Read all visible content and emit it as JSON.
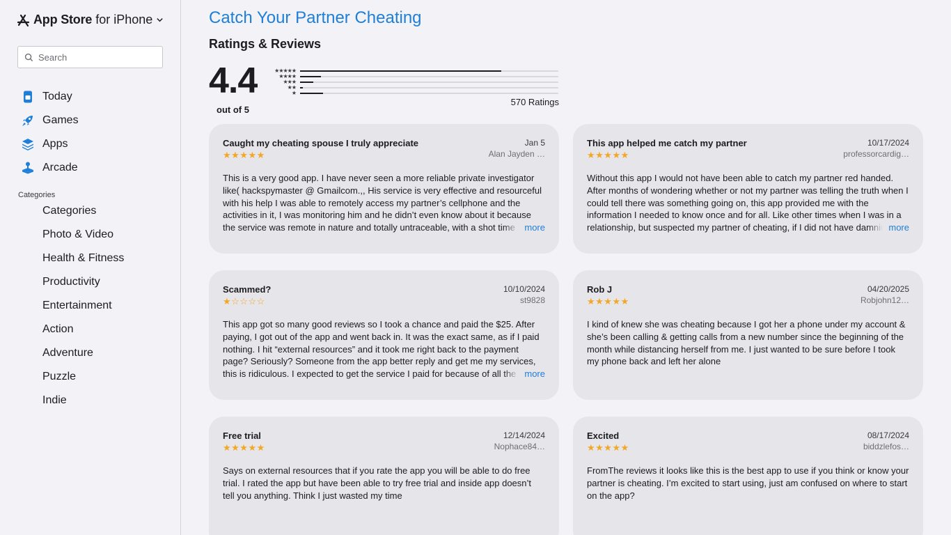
{
  "brand": {
    "name": "App Store",
    "suffix": "for iPhone"
  },
  "search": {
    "placeholder": "Search"
  },
  "nav": [
    {
      "label": "Today",
      "icon": "today-icon"
    },
    {
      "label": "Games",
      "icon": "games-rocket-icon"
    },
    {
      "label": "Apps",
      "icon": "apps-layers-icon"
    },
    {
      "label": "Arcade",
      "icon": "arcade-joystick-icon"
    }
  ],
  "categories_heading": "Categories",
  "categories": [
    "Categories",
    "Photo & Video",
    "Health & Fitness",
    "Productivity",
    "Entertainment",
    "Action",
    "Adventure",
    "Puzzle",
    "Indie"
  ],
  "app_title": "Catch Your Partner Cheating",
  "ratings": {
    "heading": "Ratings & Reviews",
    "score": "4.4",
    "out_of": "out of 5",
    "count": "570 Ratings",
    "distribution": [
      {
        "stars": "★★★★★",
        "fraction": 0.78
      },
      {
        "stars": "★★★★",
        "fraction": 0.08
      },
      {
        "stars": "★★★",
        "fraction": 0.05
      },
      {
        "stars": "★★",
        "fraction": 0.01
      },
      {
        "stars": "★",
        "fraction": 0.09
      }
    ]
  },
  "accent_color": "#1f7fd8",
  "star_color": "#f5a623",
  "reviews": [
    {
      "title": "Caught my cheating spouse I truly appreciate",
      "date": "Jan 5",
      "author": "Alan Jayden …",
      "stars": "★★★★★",
      "body": "This is a very good app. I have never seen a more reliable private investigator like( hackspymaster @ Gmailcom.,, His service is very effective and resourceful with his help I was able to remotely access my partner’s cellphone and the activities in it, I was monitoring him and he didn’t even know about it because the service was remote in nature and totally untraceable, with a shot time he",
      "more": "more"
    },
    {
      "title": "This app helped me catch my partner",
      "date": "10/17/2024",
      "author": "professorcardig…",
      "stars": "★★★★★",
      "body": "Without this app I would not have been able to catch my partner red handed. After months of wondering whether or not my partner was telling the truth when I could tell there was something going on, this app provided me with the information I needed to know once and for all. Like other times when I was in a relationship, but suspected my partner of cheating, if I did not have damning evidence",
      "more": "more"
    },
    {
      "title": "Scammed?",
      "date": "10/10/2024",
      "author": "st9828",
      "stars": "★☆☆☆☆",
      "body": "This app got so many good reviews so I took a chance and paid the $25. After paying, I got out of the app and went back in. It was the exact same, as if I paid nothing. I hit “external resources” and it took me right back to the payment page? Seriously? Someone from the app better reply and get me my services, this is ridiculous. I expected to get the service I paid for because of all the good",
      "more": "more"
    },
    {
      "title": "Rob J",
      "date": "04/20/2025",
      "author": "Robjohn12…",
      "stars": "★★★★★",
      "body": "I kind of knew she was cheating because I got her a phone under my account & she’s been calling & getting calls from a new number since the beginning of the month while distancing herself from me. I just wanted to be sure before I took my phone back and left her alone",
      "more": ""
    },
    {
      "title": "Free trial",
      "date": "12/14/2024",
      "author": "Nophace84…",
      "stars": "★★★★★",
      "body": "Says on external resources that if you rate the app you will be able to do free trial. I rated the app but have been able to try free trial and inside app doesn’t tell you anything. Think I just wasted my time",
      "more": ""
    },
    {
      "title": "Excited",
      "date": "08/17/2024",
      "author": "biddzlefos…",
      "stars": "★★★★★",
      "body": "FromThe reviews it looks like this is the best app to use if you think or know your partner is cheating. I’m excited to start using, just am confused on where to start on the app?",
      "more": ""
    }
  ]
}
